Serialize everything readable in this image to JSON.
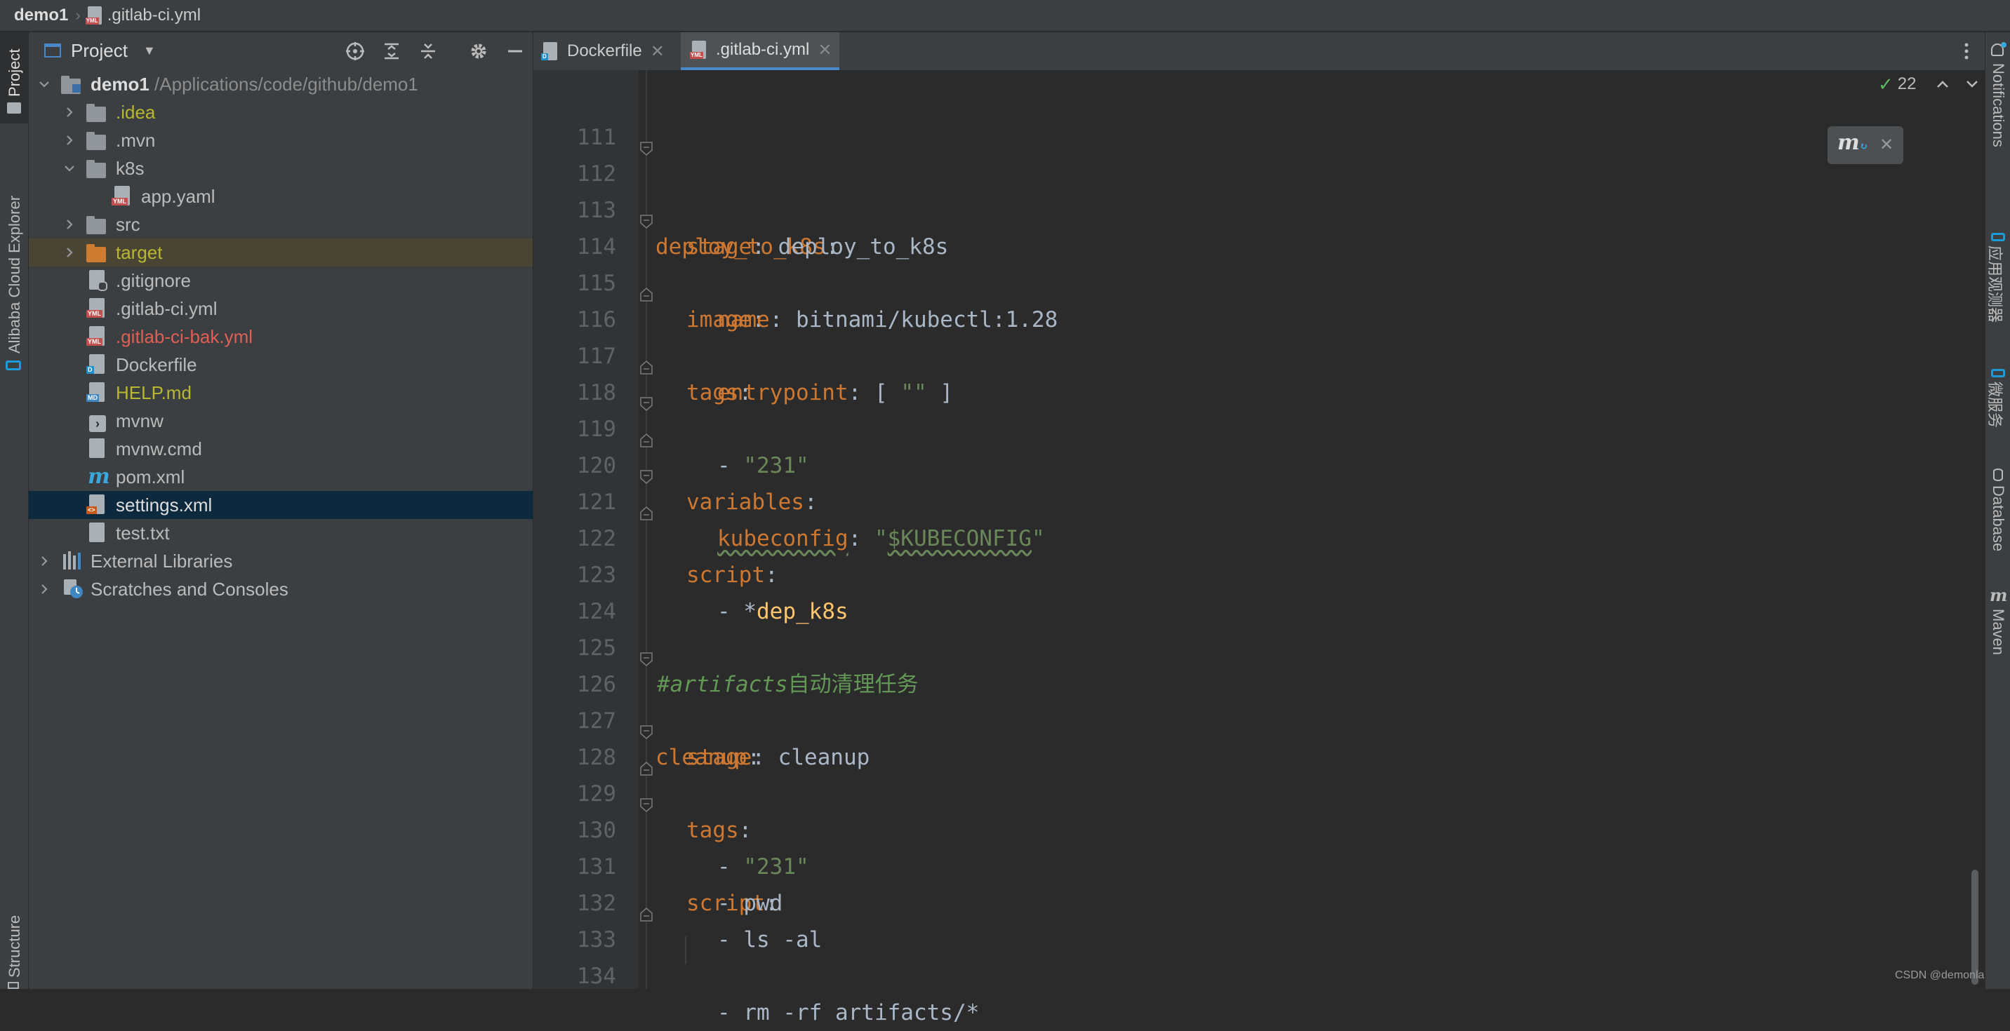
{
  "breadcrumb": {
    "project": "demo1",
    "file": ".gitlab-ci.yml"
  },
  "left_stripe": {
    "project": "Project",
    "cloud": "Alibaba Cloud Explorer",
    "structure": "Structure"
  },
  "right_stripe": {
    "notifications": "Notifications",
    "observer": "应用观测器",
    "micro": "微服务",
    "database": "Database",
    "maven": "Maven"
  },
  "project_panel": {
    "title": "Project",
    "root": {
      "name": "demo1",
      "path": "/Applications/code/github/demo1"
    },
    "items": [
      {
        "label": ".idea",
        "color": "#b8b82f"
      },
      {
        "label": ".mvn"
      },
      {
        "label": "k8s"
      },
      {
        "label": "app.yaml"
      },
      {
        "label": "src"
      },
      {
        "label": "target",
        "color": "#b8b82f"
      },
      {
        "label": ".gitignore"
      },
      {
        "label": ".gitlab-ci.yml"
      },
      {
        "label": ".gitlab-ci-bak.yml",
        "color": "#e05f55"
      },
      {
        "label": "Dockerfile"
      },
      {
        "label": "HELP.md",
        "color": "#b8b82f"
      },
      {
        "label": "mvnw"
      },
      {
        "label": "mvnw.cmd"
      },
      {
        "label": "pom.xml"
      },
      {
        "label": "settings.xml"
      },
      {
        "label": "test.txt"
      },
      {
        "label": "External Libraries"
      },
      {
        "label": "Scratches and Consoles"
      }
    ]
  },
  "tabs": [
    {
      "label": "Dockerfile"
    },
    {
      "label": ".gitlab-ci.yml"
    }
  ],
  "inspection": {
    "count": "22"
  },
  "editor": {
    "lines": {
      "n111": "111",
      "n112": "112",
      "n113": "113",
      "n114": "114",
      "n115": "115",
      "n116": "116",
      "n117": "117",
      "n118": "118",
      "n119": "119",
      "n120": "120",
      "n121": "121",
      "n122": "122",
      "n123": "123",
      "n124": "124",
      "n125": "125",
      "n126": "126",
      "n127": "127",
      "n128": "128",
      "n129": "129",
      "n130": "130",
      "n131": "131",
      "n132": "132",
      "n133": "133",
      "n134": "134"
    },
    "code": {
      "l112_key": "deploy_to_k8s",
      "l113_key": "stage",
      "l113_val": "deploy_to_k8s",
      "l114_key": "image",
      "l115_key": "name",
      "l115_val": "bitnami/kubectl:1.28",
      "l116_key": "entrypoint",
      "l116_open": "[",
      "l116_str": "\"\"",
      "l116_close": "]",
      "l117_key": "tags",
      "l118_dash": "-",
      "l118_str": "\"231\"",
      "l119_key": "variables",
      "l120_key": "kubeconfig",
      "l120_str_open": "\"",
      "l120_str_var": "$KUBECONFIG",
      "l120_str_close": "\"",
      "l121_key": "script",
      "l122_dash": "-",
      "l122_star": "*",
      "l122_alias": "dep_k8s",
      "l125_comment": "#artifacts",
      "l125_comment_zh": "自动清理任务",
      "l126_key": "cleanup",
      "l127_key": "stage",
      "l127_val": "cleanup",
      "l128_key": "tags",
      "l129_dash": "-",
      "l129_str": "\"231\"",
      "l130_key": "script",
      "l131_val": "- pwd",
      "l132_val": "- ls -al",
      "l133_val": "- rm -rf artifacts/*"
    }
  },
  "watermark": "CSDN @demonlamei"
}
